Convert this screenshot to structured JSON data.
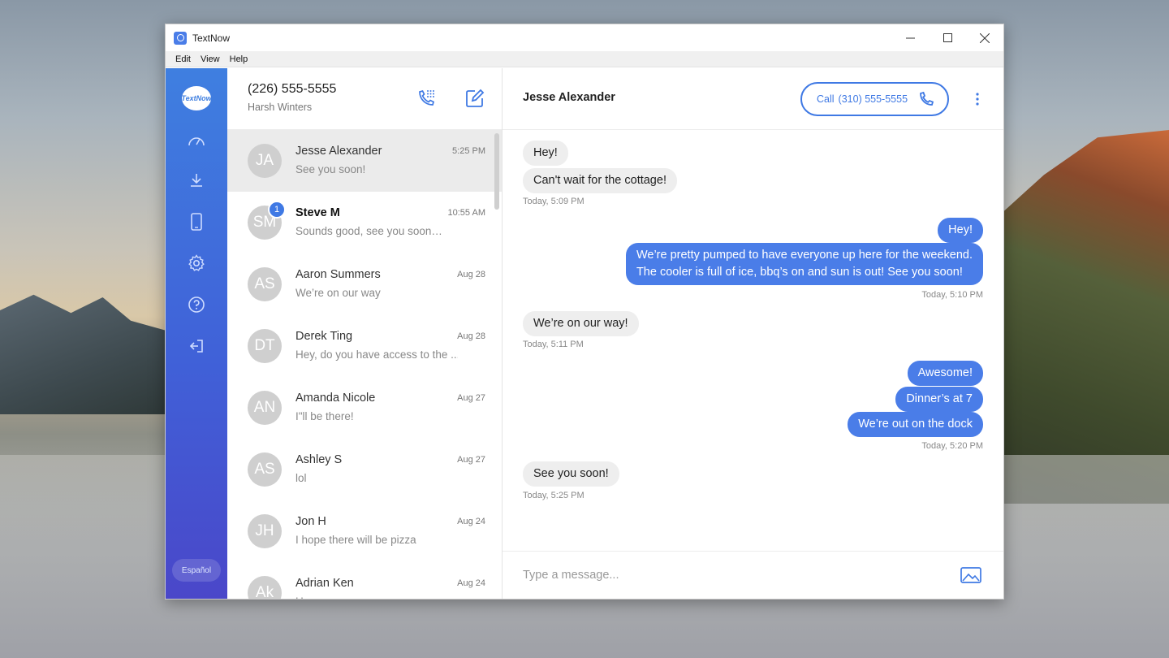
{
  "window": {
    "title": "TextNow"
  },
  "menu": [
    "Edit",
    "View",
    "Help"
  ],
  "sidenav": {
    "logo_text": "TextNow",
    "language_label": "Español",
    "icons": [
      "speedometer-icon",
      "download-icon",
      "phone-device-icon",
      "settings-icon",
      "help-icon",
      "logout-icon"
    ]
  },
  "account": {
    "number": "(226) 555-5555",
    "name": "Harsh Winters"
  },
  "conversations": [
    {
      "initials": "JA",
      "name": "Jesse Alexander",
      "preview": "See you soon!",
      "time": "5:25 PM",
      "active": true
    },
    {
      "initials": "SM",
      "name": "Steve M",
      "preview": "Sounds good, see you soon…",
      "time": "10:55 AM",
      "unread": "1"
    },
    {
      "initials": "AS",
      "name": "Aaron Summers",
      "preview": "We’re on our way",
      "time": "Aug 28"
    },
    {
      "initials": "DT",
      "name": "Derek Ting",
      "preview": "Hey, do you have access to the ...",
      "time": "Aug 28"
    },
    {
      "initials": "AN",
      "name": "Amanda Nicole",
      "preview": "I\"ll be there!",
      "time": "Aug 27"
    },
    {
      "initials": "AS",
      "name": "Ashley S",
      "preview": "lol",
      "time": "Aug 27"
    },
    {
      "initials": "JH",
      "name": "Jon H",
      "preview": "I hope there will be pizza",
      "time": "Aug 24"
    },
    {
      "initials": "Ak",
      "name": "Adrian Ken",
      "preview": "Hey",
      "time": "Aug 24"
    }
  ],
  "chat": {
    "contact": "Jesse Alexander",
    "call_label": "Call",
    "call_number": "(310) 555-5555",
    "messages": [
      {
        "dir": "in",
        "text": "Hey!"
      },
      {
        "dir": "in",
        "text": "Can't wait for the cottage!"
      },
      {
        "stamp": "Today, 5:09 PM",
        "dir": "in"
      },
      {
        "dir": "out",
        "text": "Hey!"
      },
      {
        "dir": "out",
        "text": "We’re pretty pumped to have everyone up here for the weekend.\nThe cooler is full of ice, bbq’s on and sun is out!  See you soon!"
      },
      {
        "stamp": "Today, 5:10 PM",
        "dir": "out"
      },
      {
        "dir": "in",
        "text": "We’re on our way!"
      },
      {
        "stamp": "Today, 5:11 PM",
        "dir": "in"
      },
      {
        "dir": "out",
        "text": "Awesome!"
      },
      {
        "dir": "out",
        "text": "Dinner’s at 7"
      },
      {
        "dir": "out",
        "text": "We’re out on the dock"
      },
      {
        "stamp": "Today, 5:20 PM",
        "dir": "out"
      },
      {
        "dir": "in",
        "text": "See you soon!"
      },
      {
        "stamp": "Today, 5:25 PM",
        "dir": "in"
      }
    ],
    "composer_placeholder": "Type a message..."
  },
  "colors": {
    "accent": "#3f79e4",
    "outgoing_bubble": "#4a7de8",
    "incoming_bubble": "#eeeeee"
  }
}
